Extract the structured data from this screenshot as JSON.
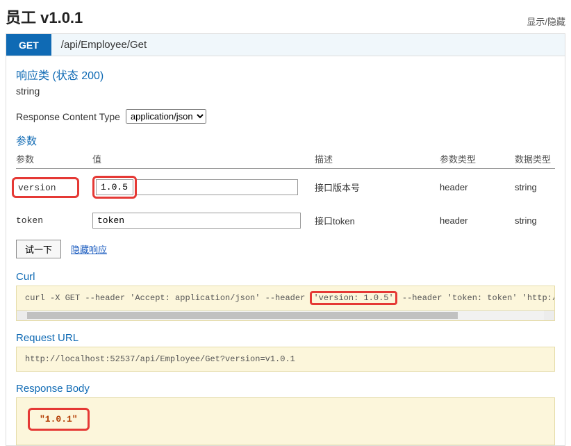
{
  "header": {
    "title": "员工 v1.0.1",
    "toggle": "显示/隐藏"
  },
  "operation": {
    "method": "GET",
    "path": "/api/Employee/Get"
  },
  "responseClass": {
    "heading": "响应类 (状态 200)",
    "type": "string"
  },
  "responseContentType": {
    "label": "Response Content Type",
    "selected": "application/json"
  },
  "paramsSection": {
    "heading": "参数",
    "columns": {
      "name": "参数",
      "value": "值",
      "desc": "描述",
      "paramType": "参数类型",
      "dataType": "数据类型"
    },
    "rows": [
      {
        "name": "version",
        "value": "1.0.5",
        "desc": "接口版本号",
        "paramType": "header",
        "dataType": "string",
        "highlight": true
      },
      {
        "name": "token",
        "value": "token",
        "desc": "接口token",
        "paramType": "header",
        "dataType": "string",
        "highlight": false
      }
    ]
  },
  "actions": {
    "tryBtn": "试一下",
    "hideResp": "隐藏响应"
  },
  "curl": {
    "heading": "Curl",
    "pre": "curl -X GET --header 'Accept: application/json' --header",
    "highlight": "'version: 1.0.5'",
    "post": " --header 'token: token' 'http://local"
  },
  "requestUrl": {
    "heading": "Request URL",
    "value": "http://localhost:52537/api/Employee/Get?version=v1.0.1"
  },
  "responseBody": {
    "heading": "Response Body",
    "value": "\"1.0.1\""
  }
}
